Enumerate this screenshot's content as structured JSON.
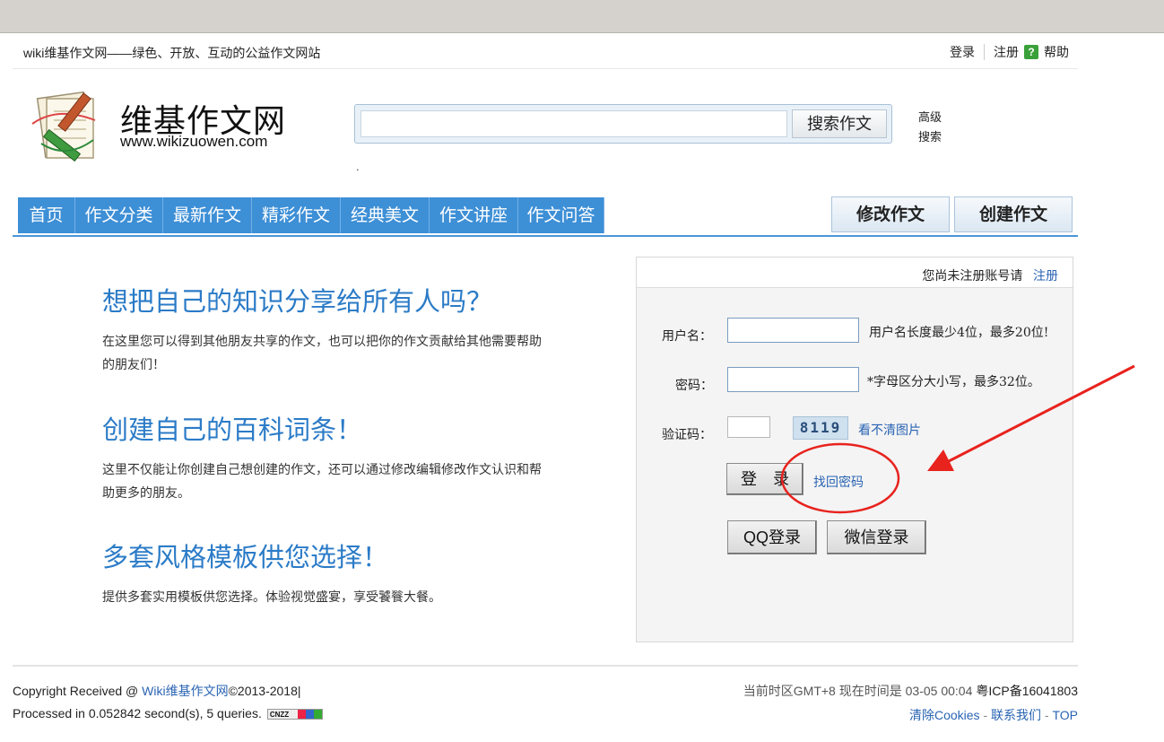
{
  "header": {
    "tagline": "wiki维基作文网——绿色、开放、互动的公益作文网站",
    "login": "登录",
    "register": "注册",
    "help_icon_glyph": "?",
    "help": "帮助"
  },
  "logo": {
    "title": "维基作文网",
    "url": "www.wikizuowen.com"
  },
  "search": {
    "placeholder": "",
    "button": "搜索作文",
    "advanced_line1": "高级",
    "advanced_line2": "搜索",
    "dot": "."
  },
  "nav": {
    "tabs": [
      "首页",
      "作文分类",
      "最新作文",
      "精彩作文",
      "经典美文",
      "作文讲座",
      "作文问答"
    ],
    "edit": "修改作文",
    "create": "创建作文"
  },
  "features": [
    {
      "title": "想把自己的知识分享给所有人吗？",
      "desc": "在这里您可以得到其他朋友共享的作文，也可以把你的作文贡献给其他需要帮助的朋友们！"
    },
    {
      "title": "创建自己的百科词条！",
      "desc": "这里不仅能让你创建自己想创建的作文，还可以通过修改编辑修改作文认识和帮助更多的朋友。"
    },
    {
      "title": "多套风格模板供您选择！",
      "desc": "提供多套实用模板供您选择。体验视觉盛宴，享受饕餮大餐。"
    }
  ],
  "login": {
    "not_registered": "您尚未注册账号请",
    "register_link": "注册",
    "username_label": "用户名：",
    "username_value": "",
    "username_hint": "用户名长度最少4位，最多20位!",
    "password_label": "密码：",
    "password_value": "",
    "password_hint": "*字母区分大小写，最多32位。",
    "captcha_label": "验证码：",
    "captcha_value": "",
    "captcha_text": "8119",
    "captcha_refresh": "看不清图片",
    "login_button": "登　录",
    "forgot": "找回密码",
    "qq_login": "QQ登录",
    "wechat_login": "微信登录"
  },
  "annotation_colors": {
    "circle": "#e8231e",
    "arrow": "#e8231e"
  },
  "footer": {
    "copyright_prefix": "Copyright Received @ ",
    "site_link": "Wiki维基作文网",
    "copyright_suffix": "©2013-2018|",
    "processed": "Processed in 0.052842 second(s), 5 queries.",
    "cnzz": "CNZZ",
    "timezone": "当前时区GMT+8 现在时间是 03-05 00:04",
    "icp": "粤ICP备16041803",
    "clear_cookies": "清除Cookies",
    "contact": "联系我们",
    "top": "TOP",
    "sep": " - "
  }
}
